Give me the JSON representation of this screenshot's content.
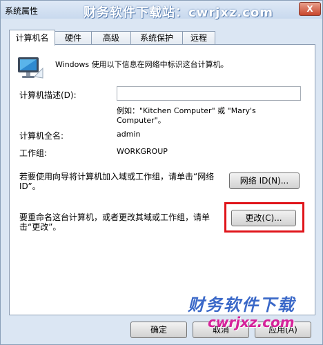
{
  "window": {
    "title": "系统属性",
    "watermark": "财务软件下载站：cwrjxz.com",
    "close_glyph": "X"
  },
  "tabs": [
    {
      "label": "计算机名",
      "active": true
    },
    {
      "label": "硬件",
      "active": false
    },
    {
      "label": "高级",
      "active": false
    },
    {
      "label": "系统保护",
      "active": false
    },
    {
      "label": "远程",
      "active": false
    }
  ],
  "panel": {
    "intro": "Windows 使用以下信息在网络中标识这台计算机。",
    "description_label": "计算机描述(D):",
    "description_value": "",
    "example_text": "例如：\"Kitchen Computer\" 或 \"Mary's Computer\"。",
    "fullname_label": "计算机全名:",
    "fullname_value": "admin",
    "workgroup_label": "工作组:",
    "workgroup_value": "WORKGROUP",
    "network_text": "若要使用向导将计算机加入域或工作组，请单击“网络 ID”。",
    "network_button": "网络 ID(N)...",
    "rename_text": "要重命名这台计算机，或者更改其域或工作组，请单击“更改”。",
    "change_button": "更改(C)..."
  },
  "footer": {
    "ok_button": "确定",
    "cancel_button": "取消",
    "apply_button": "应用(A)"
  },
  "watermark_bottom": {
    "text": "财务软件下载",
    "url": "cwrjxz.com"
  },
  "colors": {
    "highlight": "#e0141a",
    "window_bg": "#dbe6f3"
  }
}
